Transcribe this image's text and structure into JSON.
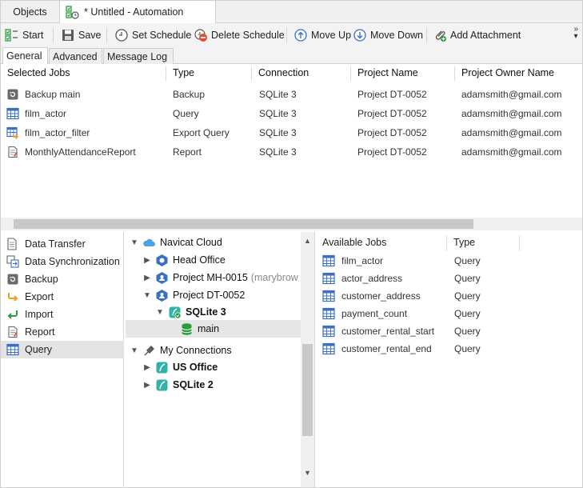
{
  "doc_tabs": {
    "objects_label": "Objects",
    "active_label": "* Untitled - Automation"
  },
  "toolbar": {
    "start_label": "Start",
    "save_label": "Save",
    "set_schedule_label": "Set Schedule",
    "delete_schedule_label": "Delete Schedule",
    "move_up_label": "Move Up",
    "move_down_label": "Move Down",
    "add_attachment_label": "Add Attachment",
    "more_glyph": "»"
  },
  "sub_tabs": [
    "General",
    "Advanced",
    "Message Log"
  ],
  "selected_jobs": {
    "columns": [
      "Selected Jobs",
      "Type",
      "Connection",
      "Project Name",
      "Project Owner Name"
    ],
    "rows": [
      {
        "name": "Backup main",
        "type": "Backup",
        "connection": "SQLite 3",
        "project": "Project DT-0052",
        "owner": "adamsmith@gmail.com",
        "icon": "backup-icon"
      },
      {
        "name": "film_actor",
        "type": "Query",
        "connection": "SQLite 3",
        "project": "Project DT-0052",
        "owner": "adamsmith@gmail.com",
        "icon": "query-icon"
      },
      {
        "name": "film_actor_filter",
        "type": "Export Query",
        "connection": "SQLite 3",
        "project": "Project DT-0052",
        "owner": "adamsmith@gmail.com",
        "icon": "export-query-icon"
      },
      {
        "name": "MonthlyAttendanceReport",
        "type": "Report",
        "connection": "SQLite 3",
        "project": "Project DT-0052",
        "owner": "adamsmith@gmail.com",
        "icon": "report-icon"
      }
    ]
  },
  "categories": [
    {
      "label": "Data Transfer",
      "icon": "data-transfer-icon"
    },
    {
      "label": "Data Synchronization",
      "icon": "data-sync-icon"
    },
    {
      "label": "Backup",
      "icon": "backup-icon"
    },
    {
      "label": "Export",
      "icon": "export-icon"
    },
    {
      "label": "Import",
      "icon": "import-icon"
    },
    {
      "label": "Report",
      "icon": "report-icon"
    },
    {
      "label": "Query",
      "icon": "query-icon",
      "selected": true
    }
  ],
  "tree": {
    "navicat_cloud": "Navicat Cloud",
    "head_office": "Head Office",
    "project_mh": "Project MH-0015",
    "project_mh_owner": "(marybrow",
    "project_dt": "Project DT-0052",
    "sqlite3": "SQLite 3",
    "main": "main",
    "my_connections": "My Connections",
    "us_office": "US Office",
    "sqlite2": "SQLite 2"
  },
  "available_jobs": {
    "columns": [
      "Available Jobs",
      "Type"
    ],
    "rows": [
      {
        "name": "film_actor",
        "type": "Query"
      },
      {
        "name": "actor_address",
        "type": "Query"
      },
      {
        "name": "customer_address",
        "type": "Query"
      },
      {
        "name": "payment_count",
        "type": "Query"
      },
      {
        "name": "customer_rental_start",
        "type": "Query"
      },
      {
        "name": "customer_rental_end",
        "type": "Query"
      }
    ]
  },
  "colors": {
    "accent_green": "#2e9b3f",
    "query_blue": "#3a6fc4",
    "selection_gray": "#e3e3e3"
  }
}
